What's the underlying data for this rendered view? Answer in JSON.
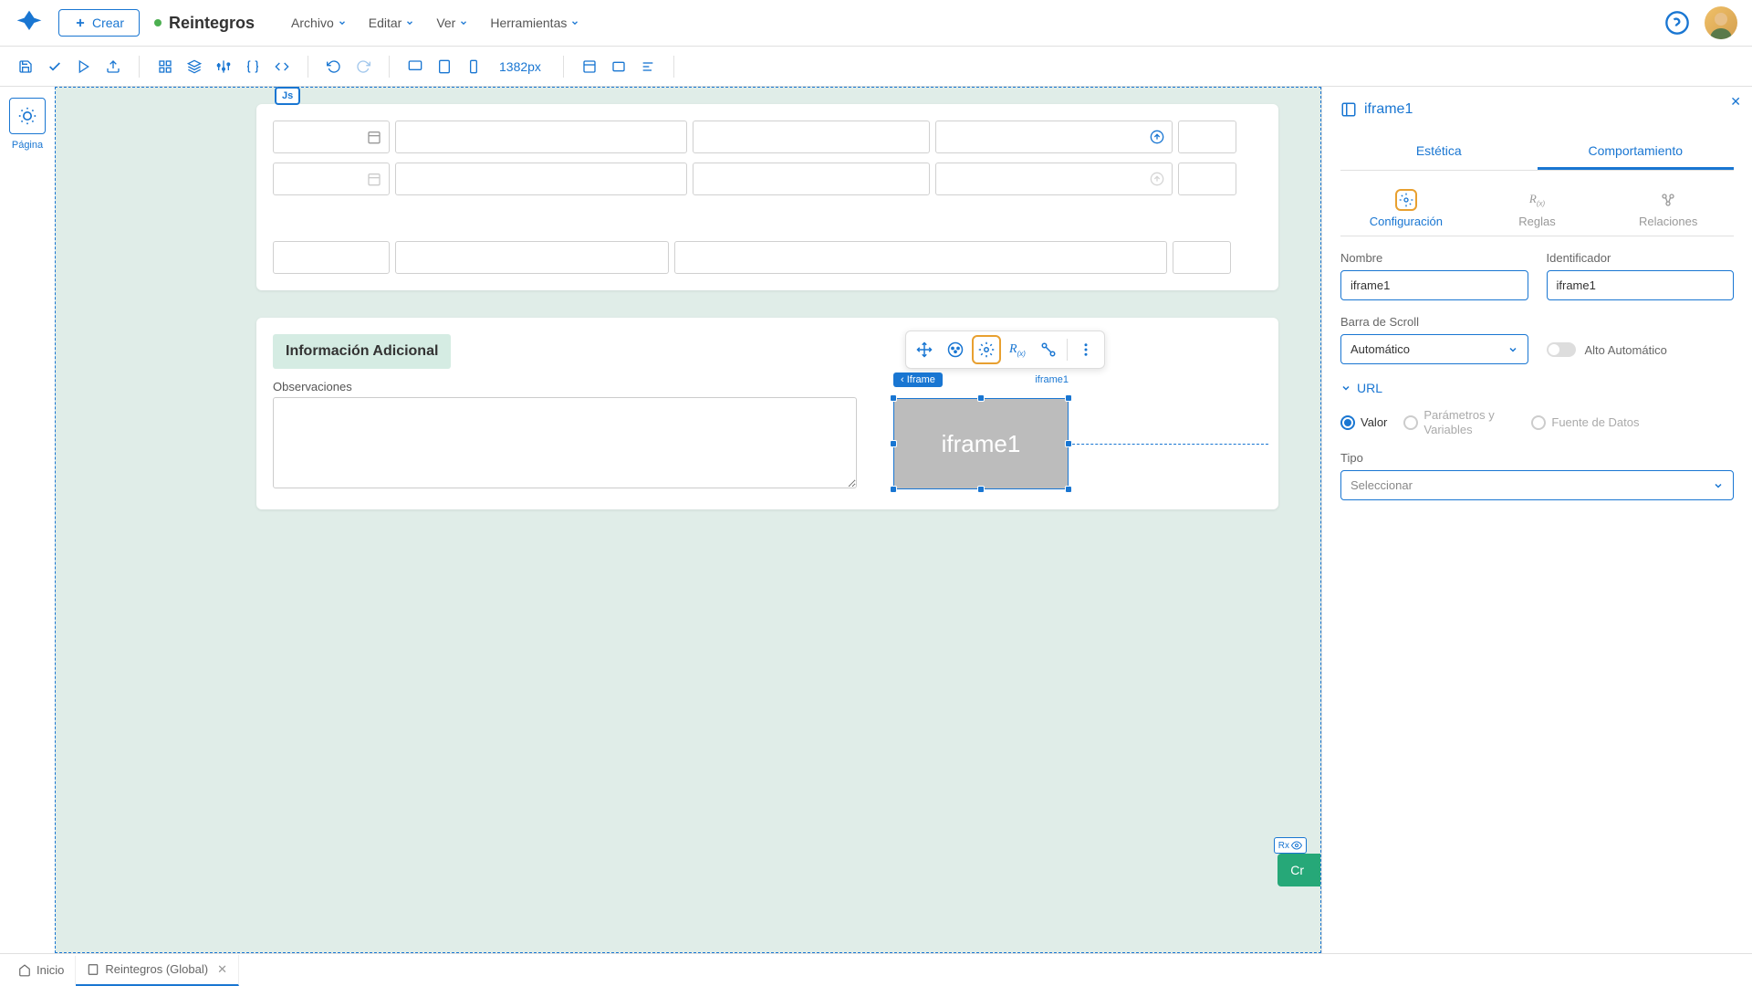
{
  "header": {
    "create_button": "Crear",
    "page_title": "Reintegros",
    "menus": [
      "Archivo",
      "Editar",
      "Ver",
      "Herramientas"
    ]
  },
  "toolbar": {
    "width_display": "1382px"
  },
  "left_sidebar": {
    "page_label": "Página"
  },
  "canvas": {
    "js_badge": "Js",
    "section_title": "Información Adicional",
    "observations_label": "Observaciones",
    "iframe_breadcrumb": "Iframe",
    "iframe_label": "iframe1",
    "iframe_placeholder": "iframe1",
    "rx_badge": "Rx",
    "green_button": "Cr"
  },
  "right_panel": {
    "title": "iframe1",
    "tabs": {
      "aesthetics": "Estética",
      "behavior": "Comportamiento"
    },
    "sub_tabs": {
      "config": "Configuración",
      "rules": "Reglas",
      "relations": "Relaciones"
    },
    "fields": {
      "name_label": "Nombre",
      "name_value": "iframe1",
      "id_label": "Identificador",
      "id_value": "iframe1",
      "scrollbar_label": "Barra de Scroll",
      "scrollbar_value": "Automático",
      "auto_height_label": "Alto Automático",
      "url_section": "URL",
      "radio_value": "Valor",
      "radio_params": "Parámetros y Variables",
      "radio_source": "Fuente de Datos",
      "type_label": "Tipo",
      "type_placeholder": "Seleccionar"
    }
  },
  "bottom_tabs": {
    "home": "Inicio",
    "current": "Reintegros (Global)"
  }
}
